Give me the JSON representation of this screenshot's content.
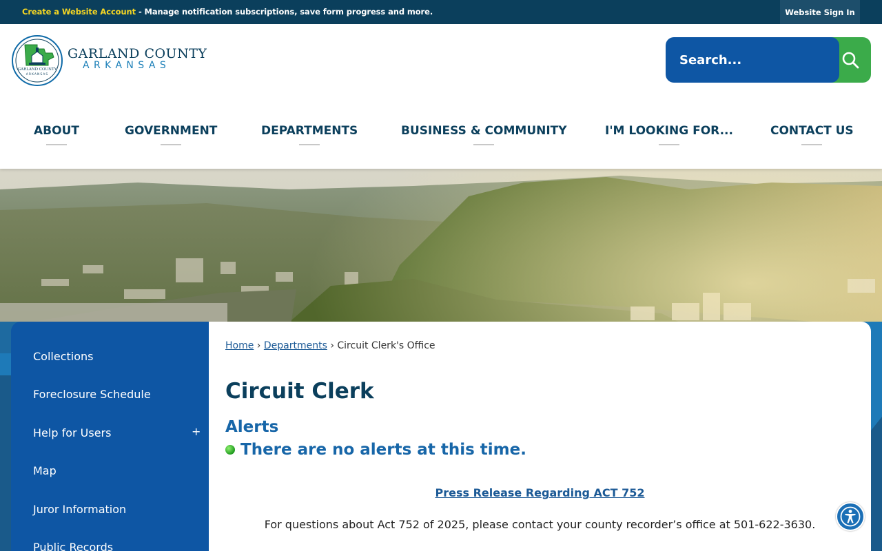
{
  "topbar": {
    "create_account_link": "Create a Website Account",
    "message": " - Manage notification subscriptions, save form progress and more.",
    "signin_label": "Website Sign In"
  },
  "logo": {
    "line1": "GARLAND COUNTY",
    "line2": "ARKANSAS",
    "seal_top": "GARLAND COUNTY",
    "seal_bottom": "ARKANSAS"
  },
  "search": {
    "placeholder": "Search..."
  },
  "nav": {
    "items": [
      "ABOUT",
      "GOVERNMENT",
      "DEPARTMENTS",
      "BUSINESS & COMMUNITY",
      "I'M LOOKING FOR...",
      "CONTACT US"
    ]
  },
  "sidebar": {
    "items": [
      "Collections",
      "Foreclosure Schedule",
      "Help for Users",
      "Map",
      "Juror Information",
      "Public Records"
    ],
    "expand_symbol": "+"
  },
  "breadcrumb": {
    "home": "Home",
    "departments": "Departments",
    "separator": "›",
    "current": "Circuit Clerk's Office"
  },
  "main": {
    "title": "Circuit Clerk",
    "alerts_heading": "Alerts",
    "alert_text": "There are no alerts at this time.",
    "press_link": "Press Release Regarding ACT 752",
    "question_text": "For questions about Act 752 of 2025, please contact your county recorder’s office at 501-622-3630."
  },
  "icons": {
    "search": "search-icon",
    "accessibility": "accessibility-icon"
  },
  "colors": {
    "top_bar": "#0b3f5c",
    "nav_text": "#0b3f5c",
    "search_field": "#0e56a4",
    "search_button": "#3bab4a",
    "sidebar": "#0e56a4",
    "link": "#1c5a96",
    "alert_green": "#1f9a1f"
  }
}
